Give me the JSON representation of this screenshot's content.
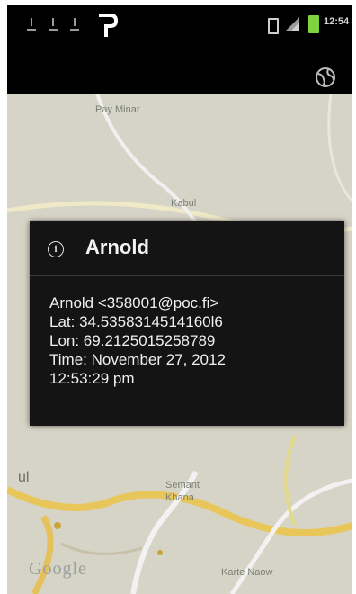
{
  "status_bar": {
    "time": "12:54",
    "icons": [
      "download-icon",
      "download-icon",
      "download-icon",
      "app-p-icon",
      "sd-card-icon",
      "signal-icon",
      "battery-icon"
    ],
    "colors": {
      "battery": "#7fd33f"
    }
  },
  "action_bar": {
    "globe_icon": "globe-icon"
  },
  "map": {
    "labels": [
      {
        "text": "Pay Minar"
      },
      {
        "text": "Kabul"
      },
      {
        "text": "ul"
      },
      {
        "text": "Semant Khana"
      },
      {
        "text": "Karte Naow"
      }
    ],
    "attribution": "Google"
  },
  "dialog": {
    "icon": "info-icon",
    "title": "Arnold",
    "lines": [
      "Arnold <358001@poc.fi>",
      "Lat: 34.5358314514160l6",
      "Lon: 69.2125015258789",
      "Time: November 27, 2012",
      "12:53:29 pm"
    ]
  }
}
